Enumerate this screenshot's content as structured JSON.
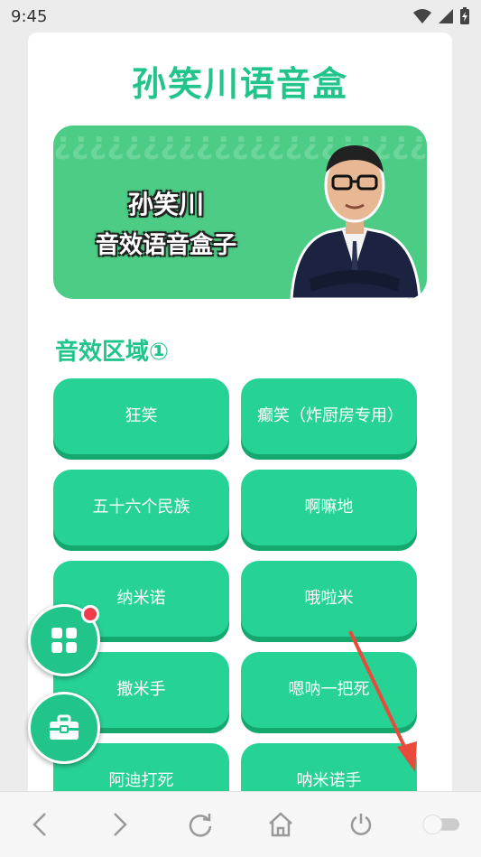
{
  "status_bar": {
    "time": "9:45"
  },
  "app": {
    "title": "孙笑川语音盒"
  },
  "banner": {
    "line1": "孙笑川",
    "line2": "音效语音盒子"
  },
  "section": {
    "title": "音效区域①"
  },
  "buttons": [
    "狂笑",
    "癫笑（炸厨房专用）",
    "五十六个民族",
    "啊嘛地",
    "纳米诺",
    "哦啦米",
    "撒米手",
    "嗯呐一把死",
    "阿迪打死",
    "呐米诺手"
  ],
  "colors": {
    "accent": "#21c58a",
    "button": "#27d295",
    "notification": "#f03c4a"
  },
  "fabs": [
    "grid-icon",
    "toolbox-icon"
  ],
  "nav_icons": [
    "back-icon",
    "forward-icon",
    "refresh-icon",
    "home-icon",
    "power-icon",
    "toggle-switch"
  ]
}
